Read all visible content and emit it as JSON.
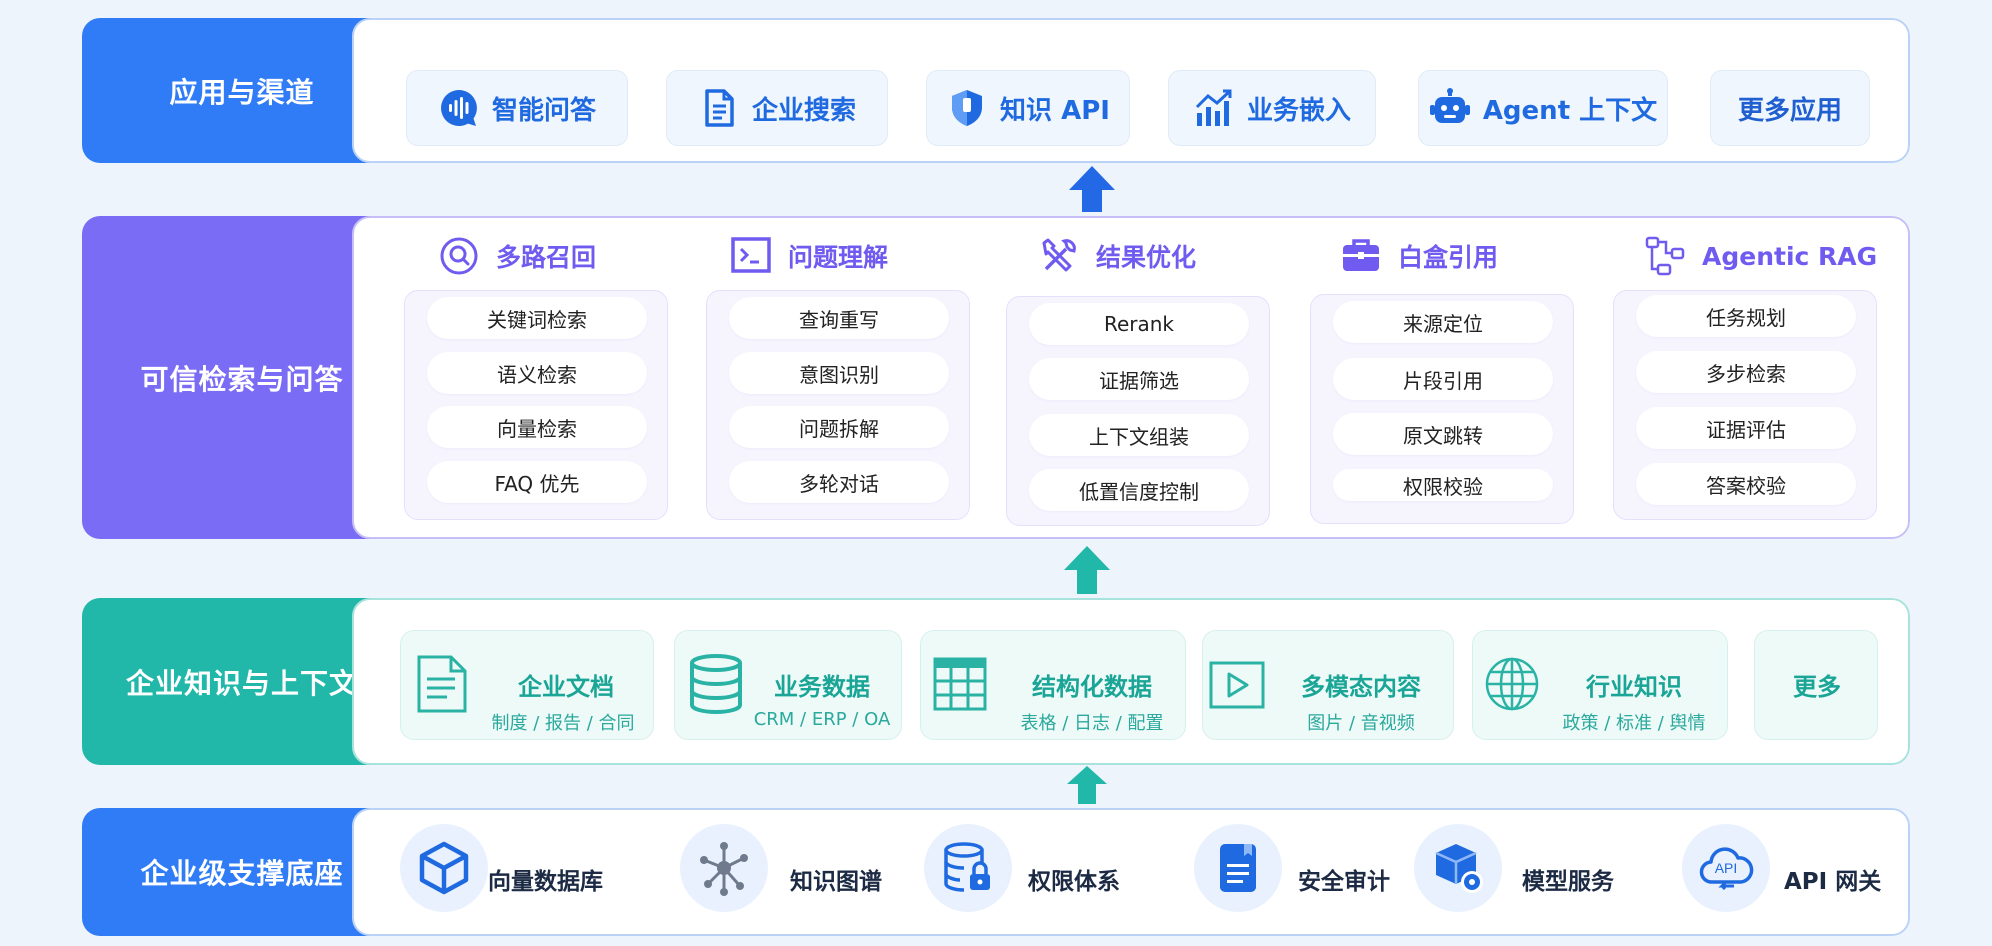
{
  "colors": {
    "blue": "#2f7cf6",
    "purple": "#7b6cf5",
    "teal": "#21b8a9"
  },
  "layers": {
    "apps": {
      "label": "应用与渠道",
      "items": [
        {
          "label": "智能问答",
          "icon": "voice-chat-icon"
        },
        {
          "label": "企业搜索",
          "icon": "document-icon"
        },
        {
          "label": "知识 API",
          "icon": "shield-icon"
        },
        {
          "label": "业务嵌入",
          "icon": "bar-chart-icon"
        },
        {
          "label": "Agent 上下文",
          "icon": "robot-icon"
        },
        {
          "label": "更多应用",
          "icon": ""
        }
      ]
    },
    "rag": {
      "label": "可信检索与问答",
      "columns": [
        {
          "title": "多路召回",
          "icon": "search-icon",
          "items": [
            "关键词检索",
            "语义检索",
            "向量检索",
            "FAQ 优先"
          ]
        },
        {
          "title": "问题理解",
          "icon": "terminal-icon",
          "items": [
            "查询重写",
            "意图识别",
            "问题拆解",
            "多轮对话"
          ]
        },
        {
          "title": "结果优化",
          "icon": "tools-icon",
          "items": [
            "Rerank",
            "证据筛选",
            "上下文组装",
            "低置信度控制"
          ]
        },
        {
          "title": "白盒引用",
          "icon": "briefcase-icon",
          "items": [
            "来源定位",
            "片段引用",
            "原文跳转",
            "权限校验"
          ]
        },
        {
          "title": "Agentic RAG",
          "icon": "workflow-icon",
          "items": [
            "任务规划",
            "多步检索",
            "证据评估",
            "答案校验"
          ]
        }
      ]
    },
    "knowledge": {
      "label": "企业知识与上下文",
      "items": [
        {
          "title": "企业文档",
          "sub": "制度 / 报告 / 合同",
          "icon": "file-icon"
        },
        {
          "title": "业务数据",
          "sub": "CRM / ERP / OA",
          "icon": "database-icon"
        },
        {
          "title": "结构化数据",
          "sub": "表格 / 日志 / 配置",
          "icon": "table-icon"
        },
        {
          "title": "多模态内容",
          "sub": "图片 / 音视频",
          "icon": "video-icon"
        },
        {
          "title": "行业知识",
          "sub": "政策 / 标准 / 舆情",
          "icon": "globe-icon"
        },
        {
          "title": "更多",
          "sub": "",
          "icon": ""
        }
      ]
    },
    "base": {
      "label": "企业级支撑底座",
      "items": [
        {
          "label": "向量数据库",
          "icon": "cube-icon"
        },
        {
          "label": "知识图谱",
          "icon": "graph-icon"
        },
        {
          "label": "权限体系",
          "icon": "database-lock-icon"
        },
        {
          "label": "安全审计",
          "icon": "audit-doc-icon"
        },
        {
          "label": "模型服务",
          "icon": "model-box-icon"
        },
        {
          "label": "API 网关",
          "icon": "api-cloud-icon"
        }
      ]
    }
  }
}
